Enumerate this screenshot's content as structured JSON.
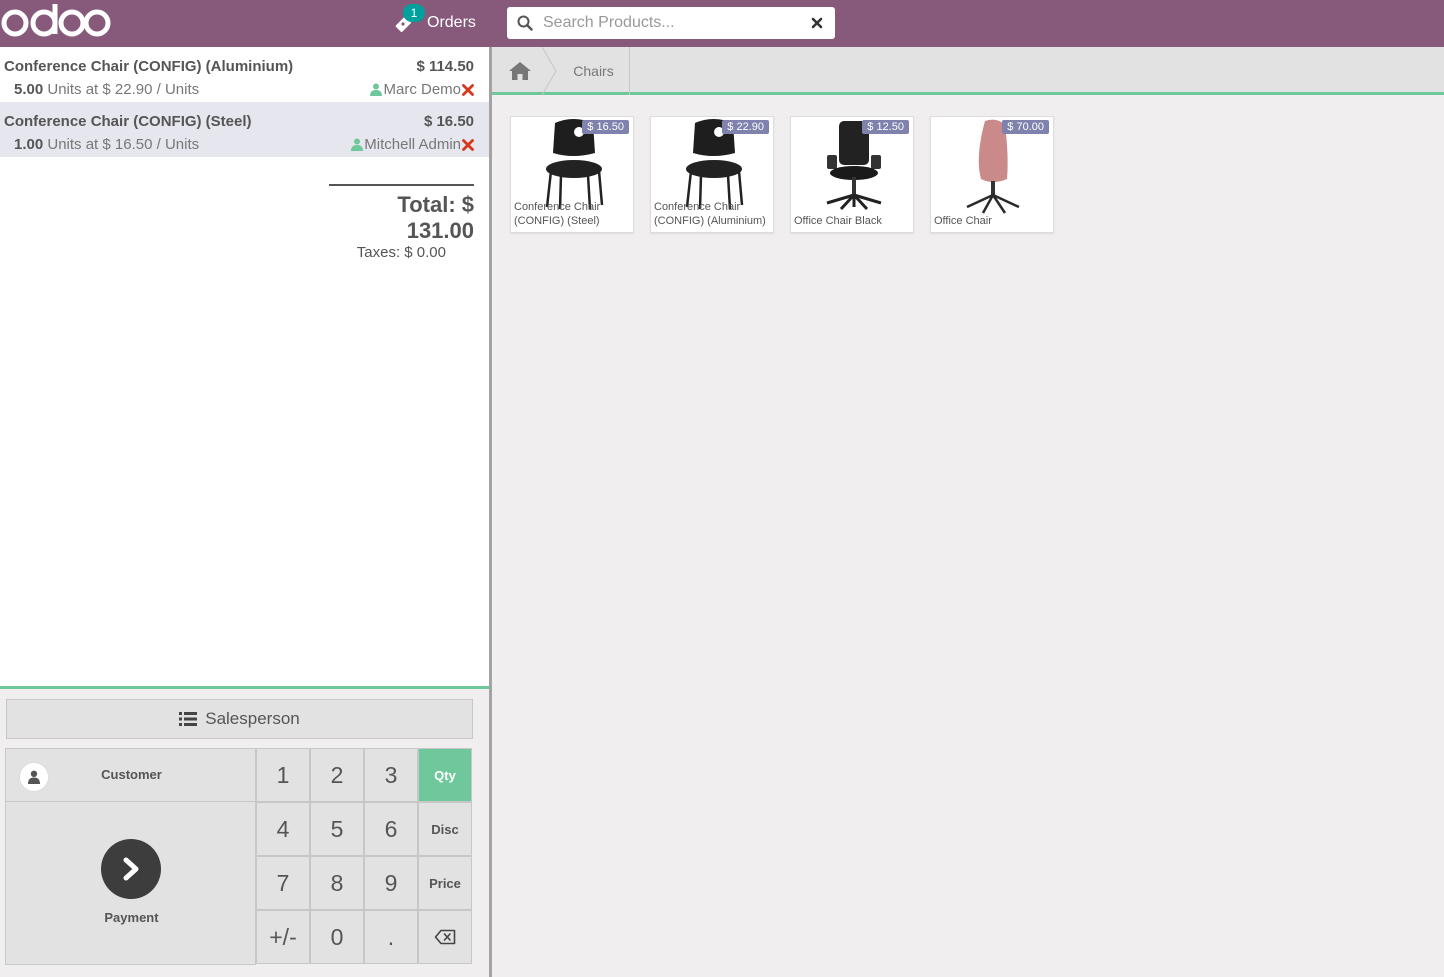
{
  "header": {
    "logo_text": "odoo",
    "orders": {
      "label": "Orders",
      "count": "1"
    },
    "search": {
      "placeholder": "Search Products...",
      "value": ""
    }
  },
  "order": {
    "lines": [
      {
        "product": "Conference Chair (CONFIG) (Aluminium)",
        "price": "$ 114.50",
        "qty": "5.00",
        "unit_text": "Units at $ 22.90 / Units",
        "salesperson": "Marc Demo",
        "selected": false
      },
      {
        "product": "Conference Chair (CONFIG) (Steel)",
        "price": "$ 16.50",
        "qty": "1.00",
        "unit_text": "Units at $ 16.50 / Units",
        "salesperson": "Mitchell Admin",
        "selected": true
      }
    ],
    "total_label": "Total: $ 131.00",
    "taxes_label": "Taxes: $ 0.00"
  },
  "controls": {
    "salesperson_label": "Salesperson",
    "customer_label": "Customer",
    "payment_label": "Payment",
    "keys": [
      "1",
      "2",
      "3",
      "4",
      "5",
      "6",
      "7",
      "8",
      "9",
      "+/-",
      "0",
      "."
    ],
    "modes": [
      "Qty",
      "Disc",
      "Price"
    ],
    "active_mode": "Qty"
  },
  "breadcrumb": {
    "home_icon": "home-icon",
    "category": "Chairs"
  },
  "products": [
    {
      "name": "Conference Chair (CONFIG) (Steel)",
      "price": "$ 16.50",
      "color": "#1e1e1e"
    },
    {
      "name": "Conference Chair (CONFIG) (Aluminium)",
      "price": "$ 22.90",
      "color": "#1e1e1e"
    },
    {
      "name": "Office Chair Black",
      "price": "$ 12.50",
      "color": "#222222"
    },
    {
      "name": "Office Chair",
      "price": "$ 70.00",
      "color": "#c98a89"
    }
  ],
  "colors": {
    "header": "#875a7b",
    "accent": "#6ec89b",
    "badge": "#00a09d",
    "price_tag": "#7f82ac",
    "remove": "#d9371b",
    "salesperson_icon": "#6ec89b"
  }
}
